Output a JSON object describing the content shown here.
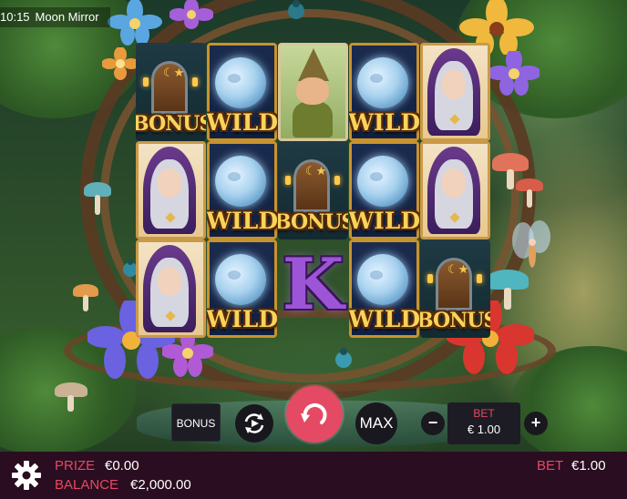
{
  "status_bar": {
    "time": "10:15",
    "game_title": "Moon Mirror"
  },
  "reels": [
    [
      "bonus",
      "witch",
      "witch"
    ],
    [
      "wild",
      "wild",
      "wild"
    ],
    [
      "gnome",
      "bonus",
      "K"
    ],
    [
      "wild",
      "wild",
      "wild"
    ],
    [
      "witch",
      "witch",
      "bonus"
    ]
  ],
  "symbol_labels": {
    "wild": "WILD",
    "bonus": "BONUS",
    "letter_k": "K"
  },
  "controls": {
    "bonus_label": "BONUS",
    "max_label": "MAX",
    "minus_label": "−",
    "plus_label": "+",
    "bet_label": "BET",
    "bet_value": "€ 1.00"
  },
  "footer": {
    "prize_label": "PRIZE",
    "prize_value": "€0.00",
    "balance_label": "BALANCE",
    "balance_value": "€2,000.00",
    "bet_label": "BET",
    "bet_value": "€1.00"
  },
  "icons": {
    "settings": "gear-icon",
    "autoplay": "autoplay-icon",
    "spin": "spin-icon"
  },
  "colors": {
    "accent": "#e44a63",
    "footer_bg": "#2a0d20",
    "gold": "#f7d45a"
  }
}
